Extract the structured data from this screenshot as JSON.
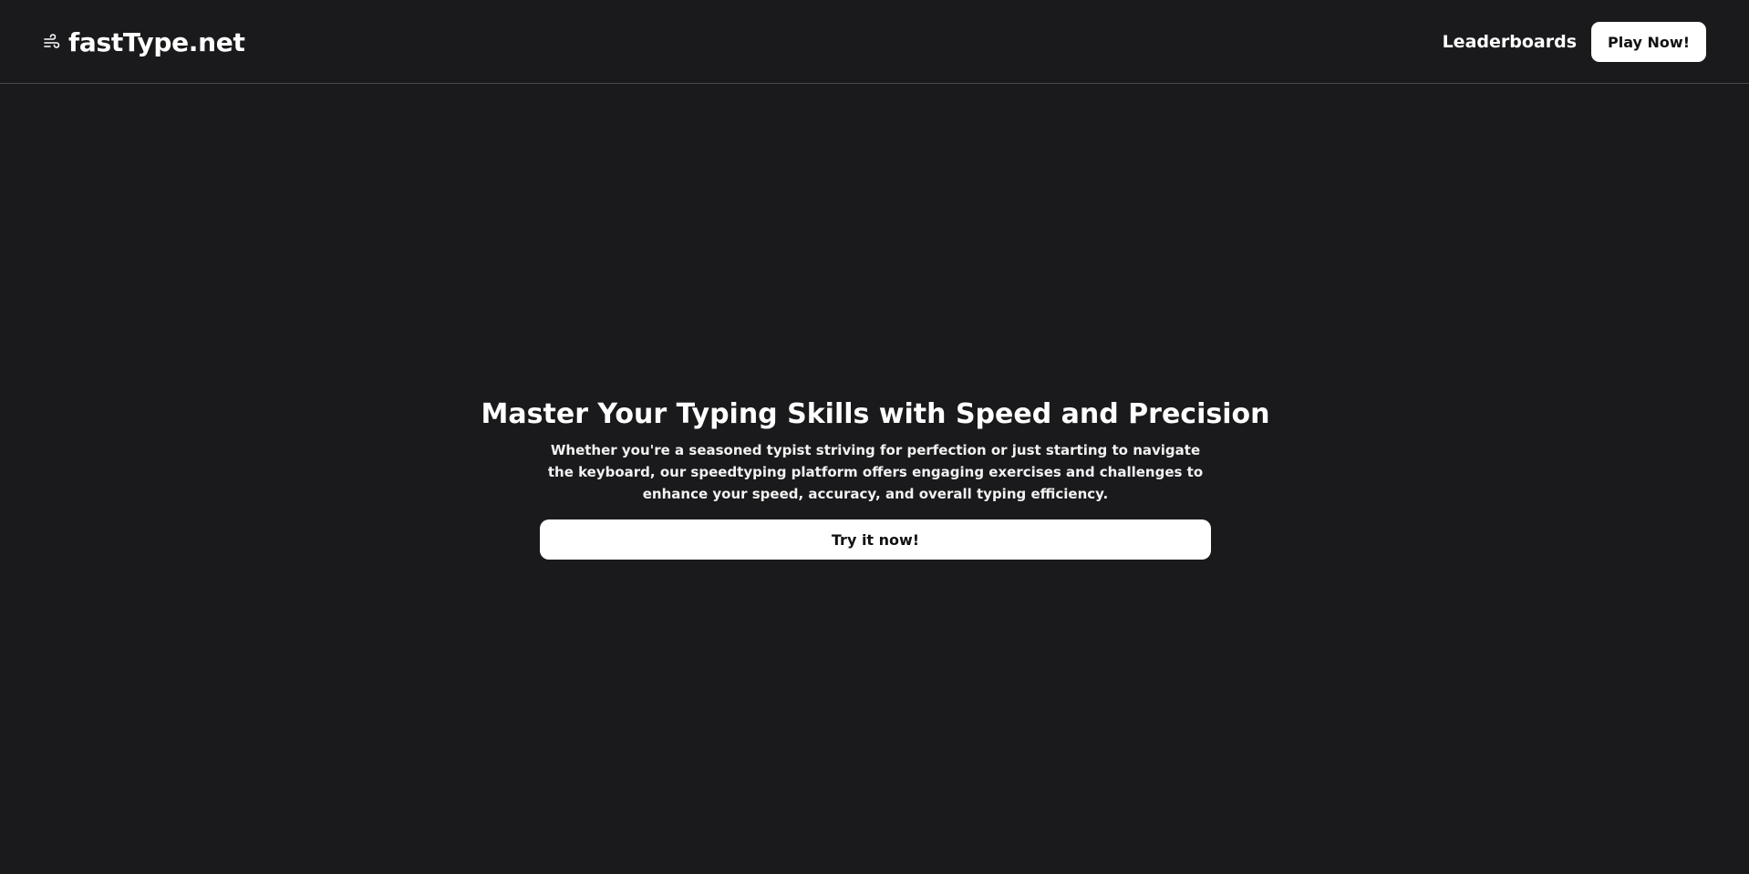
{
  "header": {
    "brand_icon": "wind-icon",
    "brand_name": "fastType.net",
    "nav": {
      "leaderboards_label": "Leaderboards",
      "play_now_label": "Play Now!"
    }
  },
  "hero": {
    "title": "Master Your Typing Skills with Speed and Precision",
    "description": "Whether you're a seasoned typist striving for perfection or just starting to navigate the keyboard, our speedtyping platform offers engaging exercises and challenges to enhance your speed, accuracy, and overall typing efficiency.",
    "cta_label": "Try it now!"
  },
  "colors": {
    "background": "#1a1a1c",
    "text": "#ffffff",
    "button_bg": "#ffffff",
    "button_text": "#111113",
    "divider": "#4a4a4e"
  }
}
